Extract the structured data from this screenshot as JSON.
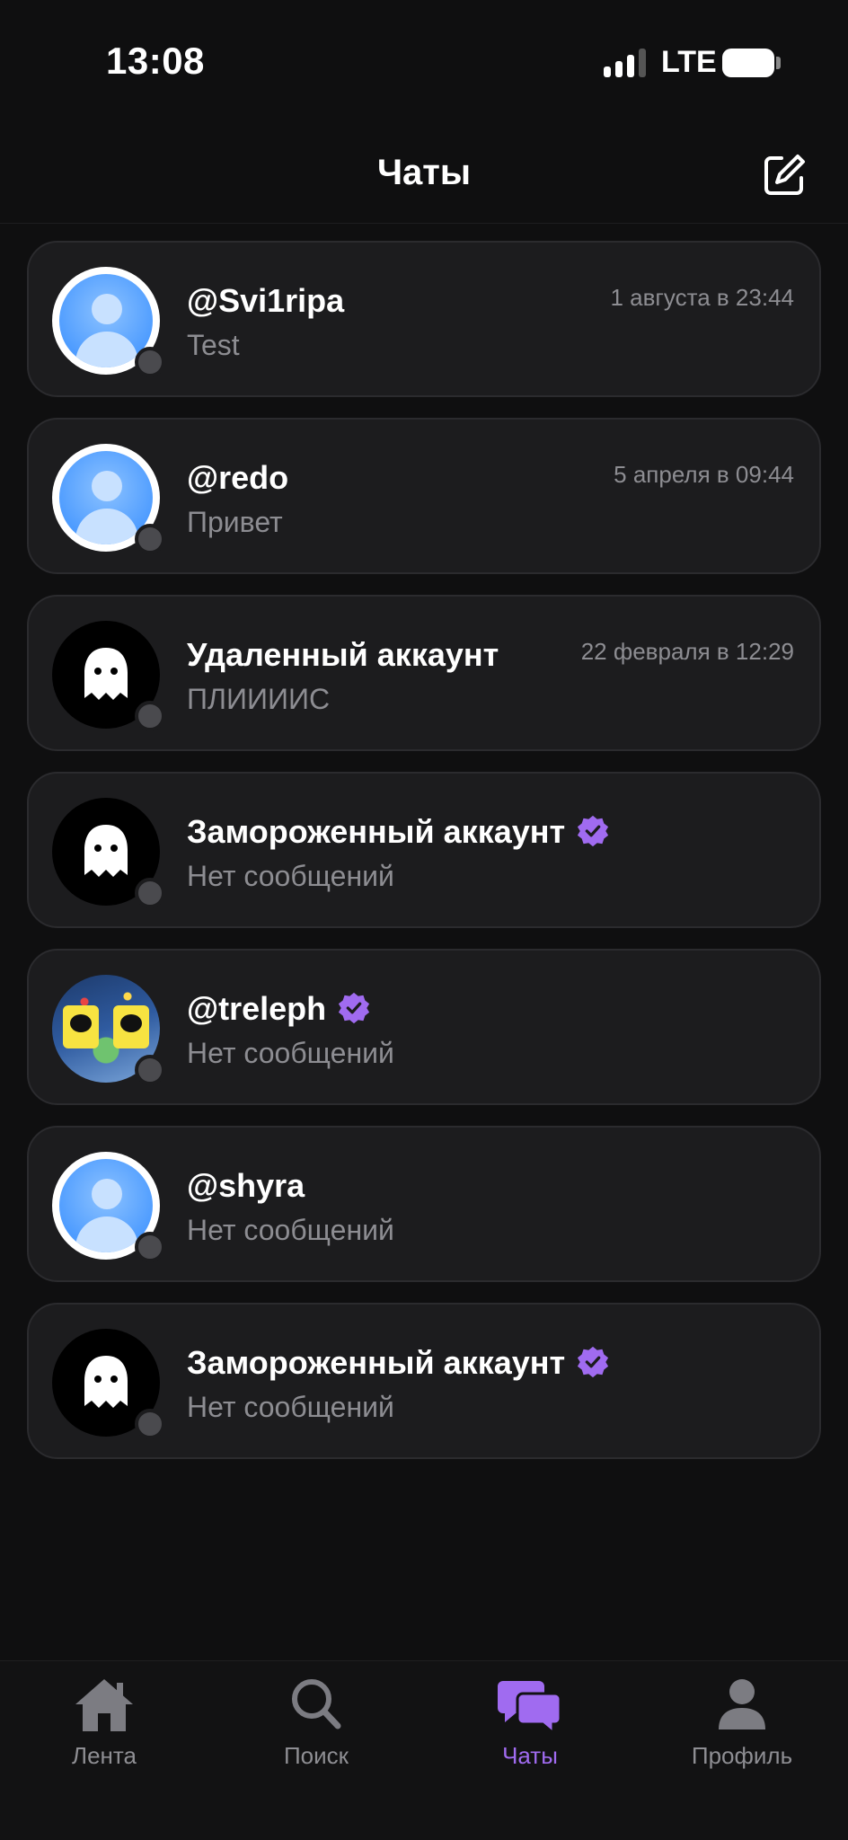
{
  "status_bar": {
    "time": "13:08",
    "network": "LTE"
  },
  "header": {
    "title": "Чаты",
    "compose_icon": "compose-icon"
  },
  "chats": [
    {
      "name": "@Svi1ripa",
      "preview": "Test",
      "time": "1 августа в 23:44",
      "avatar": "default-user-avatar",
      "verified": false
    },
    {
      "name": "@redo",
      "preview": "Привет",
      "time": "5 апреля в 09:44",
      "avatar": "default-user-avatar",
      "verified": false
    },
    {
      "name": "Удаленный аккаунт",
      "preview": "ПЛИИИИС",
      "time": "22 февраля в 12:29",
      "avatar": "ghost-avatar",
      "verified": false
    },
    {
      "name": "Замороженный аккаунт",
      "preview": "Нет сообщений",
      "time": "",
      "avatar": "ghost-avatar",
      "verified": true
    },
    {
      "name": "@treleph",
      "preview": "Нет сообщений",
      "time": "",
      "avatar": "photo-avatar",
      "verified": true
    },
    {
      "name": "@shyra",
      "preview": "Нет сообщений",
      "time": "",
      "avatar": "default-user-avatar",
      "verified": false
    },
    {
      "name": "Замороженный аккаунт",
      "preview": "Нет сообщений",
      "time": "",
      "avatar": "ghost-avatar",
      "verified": true
    }
  ],
  "tab_bar": {
    "tabs": [
      {
        "label": "Лента",
        "icon": "home-icon",
        "active": false
      },
      {
        "label": "Поиск",
        "icon": "search-icon",
        "active": false
      },
      {
        "label": "Чаты",
        "icon": "chat-bubbles-icon",
        "active": true
      },
      {
        "label": "Профиль",
        "icon": "person-icon",
        "active": false
      }
    ]
  },
  "colors": {
    "background": "#0f0f10",
    "card": "#1c1c1e",
    "accent": "#a06bf0",
    "secondary_text": "#8d8d92",
    "offline_dot": "#4a4a4e"
  }
}
